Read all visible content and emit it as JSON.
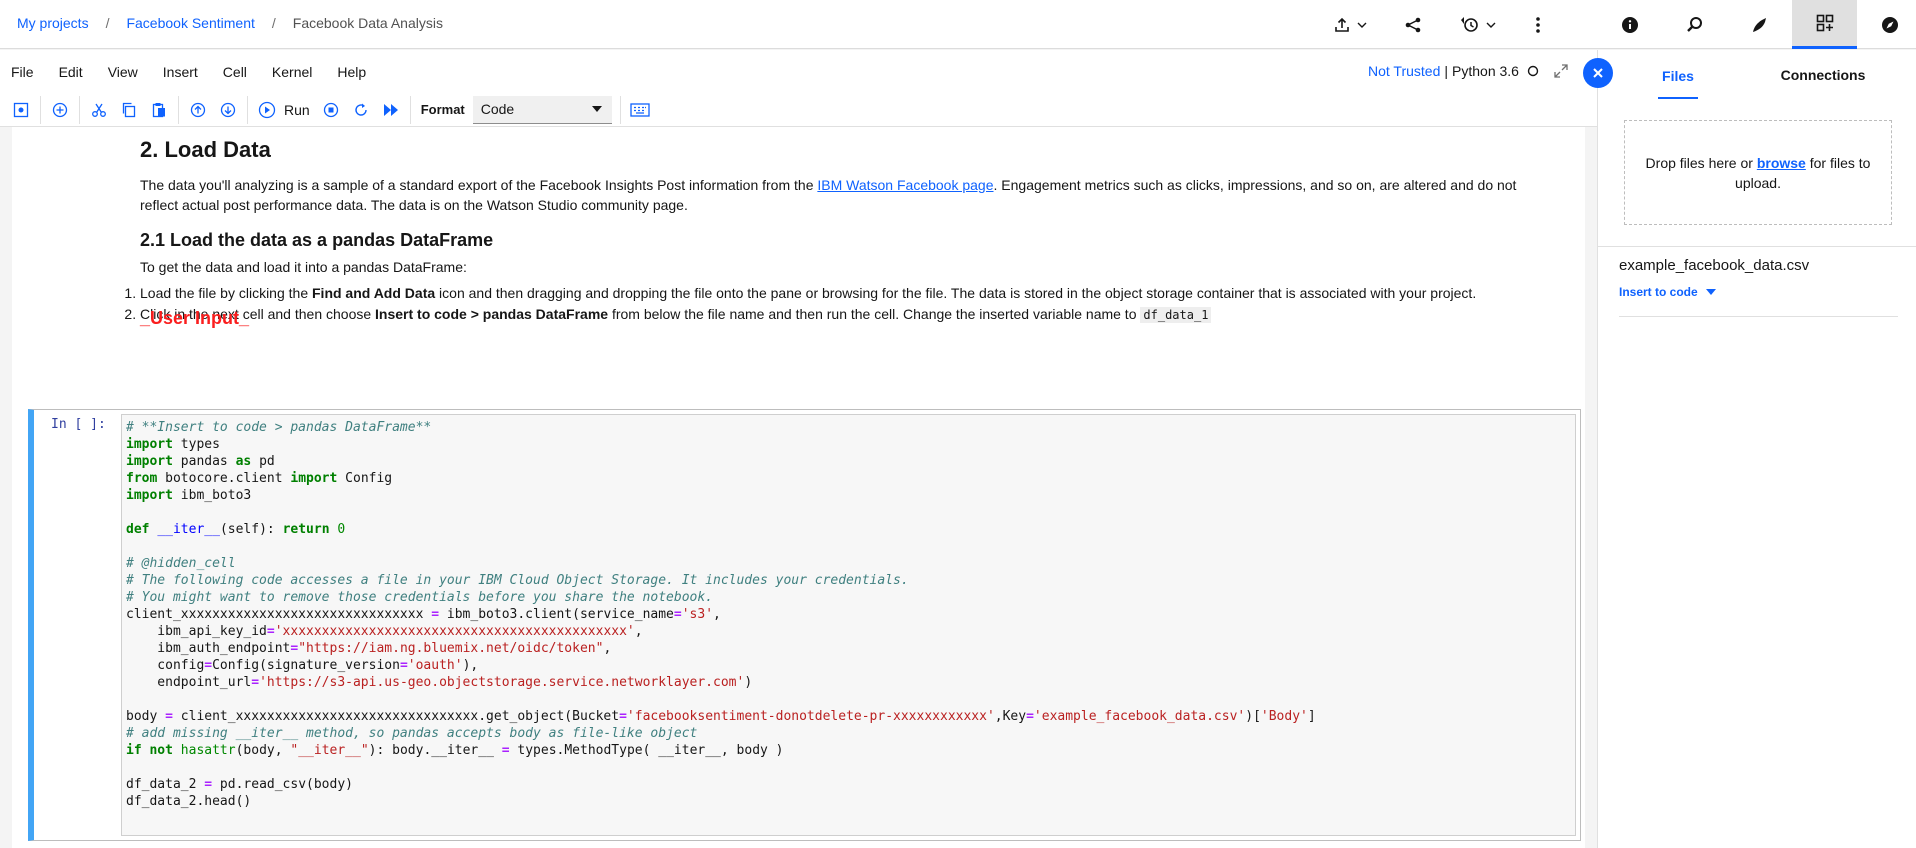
{
  "breadcrumb": {
    "items": [
      "My projects",
      "Facebook Sentiment"
    ],
    "current": "Facebook Data Analysis",
    "separator": "/"
  },
  "top_actions": [
    "upload-icon",
    "share-icon",
    "version-history-icon",
    "overflow-menu-icon"
  ],
  "right_tabs": [
    "info-icon",
    "find-replace-icon",
    "environment-icon",
    "data-assets-icon",
    "explore-icon"
  ],
  "menu": {
    "items": [
      "File",
      "Edit",
      "View",
      "Insert",
      "Cell",
      "Kernel",
      "Help"
    ]
  },
  "kernel": {
    "trust": "Not Trusted",
    "divider": "|",
    "name": "Python 3.6"
  },
  "toolbar": {
    "run_label": "Run",
    "format_label": "Format",
    "format_value": "Code"
  },
  "notebook": {
    "h2": "2. Load Data",
    "p1_before": "The data you'll analyzing is a sample of a standard export of the Facebook Insights Post information from the ",
    "p1_link": "IBM Watson Facebook page",
    "p1_after": ". Engagement metrics such as clicks, impressions, and so on, are altered and do not reflect actual post performance data. The data is on the Watson Studio community page.",
    "h3": "2.1 Load the data as a pandas DataFrame",
    "p2": "To get the data and load it into a pandas DataFrame:",
    "li1_a": "Load the file by clicking the ",
    "li1_b": "Find and Add Data",
    "li1_c": " icon and then dragging and dropping the file onto the pane or browsing for the file. The data is stored in the object storage container that is associated with your project.",
    "li2_a": "Click in the next cell and then choose ",
    "li2_b": "Insert to code > pandas DataFrame",
    "li2_c": " from below the file name and then run the cell. Change the inserted variable name to ",
    "li2_code": "df_data_1",
    "user_input": "_User Input_"
  },
  "cell": {
    "prompt": "In [ ]:",
    "code": [
      "# **Insert to code > pandas DataFrame**",
      "import types",
      "import pandas as pd",
      "from botocore.client import Config",
      "import ibm_boto3",
      "",
      "def __iter__(self): return 0",
      "",
      "# @hidden_cell",
      "# The following code accesses a file in your IBM Cloud Object Storage. It includes your credentials.",
      "# You might want to remove those credentials before you share the notebook.",
      "client_xxxxxxxxxxxxxxxxxxxxxxxxxxxxxxx = ibm_boto3.client(service_name='s3',",
      "    ibm_api_key_id='xxxxxxxxxxxxxxxxxxxxxxxxxxxxxxxxxxxxxxxxxxxx',",
      "    ibm_auth_endpoint=\"https://iam.ng.bluemix.net/oidc/token\",",
      "    config=Config(signature_version='oauth'),",
      "    endpoint_url='https://s3-api.us-geo.objectstorage.service.networklayer.com')",
      "",
      "body = client_xxxxxxxxxxxxxxxxxxxxxxxxxxxxxxx.get_object(Bucket='facebooksentiment-donotdelete-pr-xxxxxxxxxxxx',Key='example_facebook_data.csv')['Body']",
      "# add missing __iter__ method, so pandas accepts body as file-like object",
      "if not hasattr(body, \"__iter__\"): body.__iter__ = types.MethodType( __iter__, body )",
      "",
      "df_data_2 = pd.read_csv(body)",
      "df_data_2.head()"
    ]
  },
  "panel": {
    "tabs": [
      "Files",
      "Connections"
    ],
    "drop_before": "Drop files here or ",
    "drop_link": "browse",
    "drop_after": " for files to upload.",
    "file_name": "example_facebook_data.csv",
    "insert_label": "Insert to code"
  },
  "colors": {
    "accent": "#0f62fe",
    "cell_border": "#42a5f5",
    "user_input": "#fa1e1e"
  }
}
